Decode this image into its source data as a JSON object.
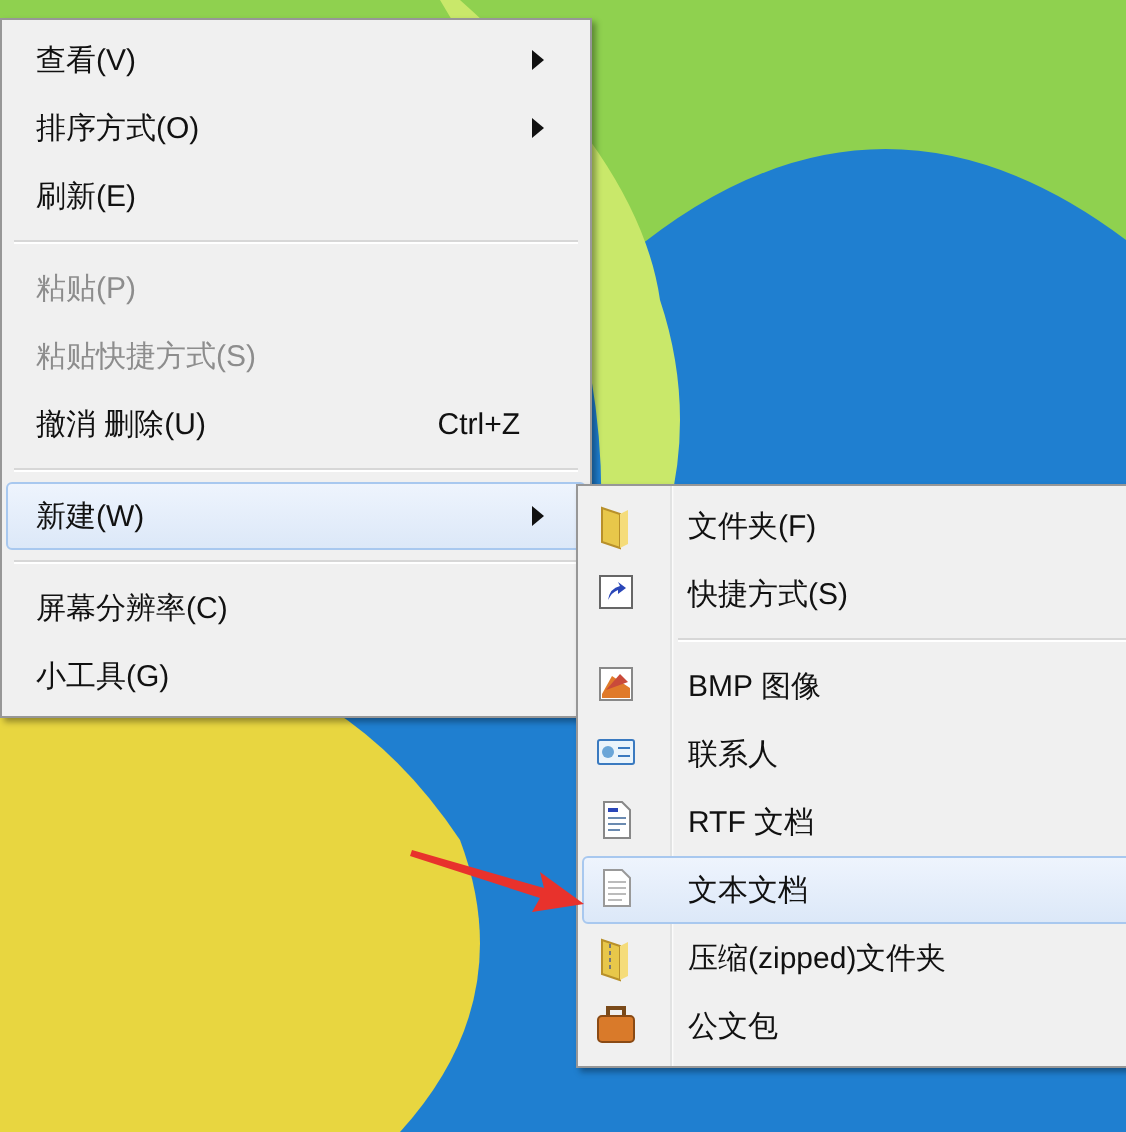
{
  "context_menu": {
    "items": [
      {
        "kind": "item",
        "label": "查看(V)",
        "submenu": true,
        "disabled": false,
        "selected": false
      },
      {
        "kind": "item",
        "label": "排序方式(O)",
        "submenu": true,
        "disabled": false,
        "selected": false
      },
      {
        "kind": "item",
        "label": "刷新(E)",
        "submenu": false,
        "disabled": false,
        "selected": false
      },
      {
        "kind": "separator"
      },
      {
        "kind": "item",
        "label": "粘贴(P)",
        "submenu": false,
        "disabled": true,
        "selected": false
      },
      {
        "kind": "item",
        "label": "粘贴快捷方式(S)",
        "submenu": false,
        "disabled": true,
        "selected": false
      },
      {
        "kind": "item",
        "label": "撤消 删除(U)",
        "shortcut": "Ctrl+Z",
        "submenu": false,
        "disabled": false,
        "selected": false
      },
      {
        "kind": "separator"
      },
      {
        "kind": "item",
        "label": "新建(W)",
        "submenu": true,
        "disabled": false,
        "selected": true
      },
      {
        "kind": "separator"
      },
      {
        "kind": "item",
        "label": "屏幕分辨率(C)",
        "submenu": false,
        "disabled": false,
        "selected": false
      },
      {
        "kind": "item",
        "label": "小工具(G)",
        "submenu": false,
        "disabled": false,
        "selected": false
      }
    ]
  },
  "new_submenu": {
    "items": [
      {
        "kind": "item",
        "label": "文件夹(F)",
        "selected": false
      },
      {
        "kind": "item",
        "label": "快捷方式(S)",
        "selected": false
      },
      {
        "kind": "separator"
      },
      {
        "kind": "item",
        "label": "BMP 图像",
        "selected": false
      },
      {
        "kind": "item",
        "label": "联系人",
        "selected": false
      },
      {
        "kind": "item",
        "label": "RTF 文档",
        "selected": false
      },
      {
        "kind": "item",
        "label": "文本文档",
        "selected": true
      },
      {
        "kind": "item",
        "label": "压缩(zipped)文件夹",
        "selected": false
      },
      {
        "kind": "item",
        "label": "公文包",
        "selected": false
      }
    ]
  }
}
